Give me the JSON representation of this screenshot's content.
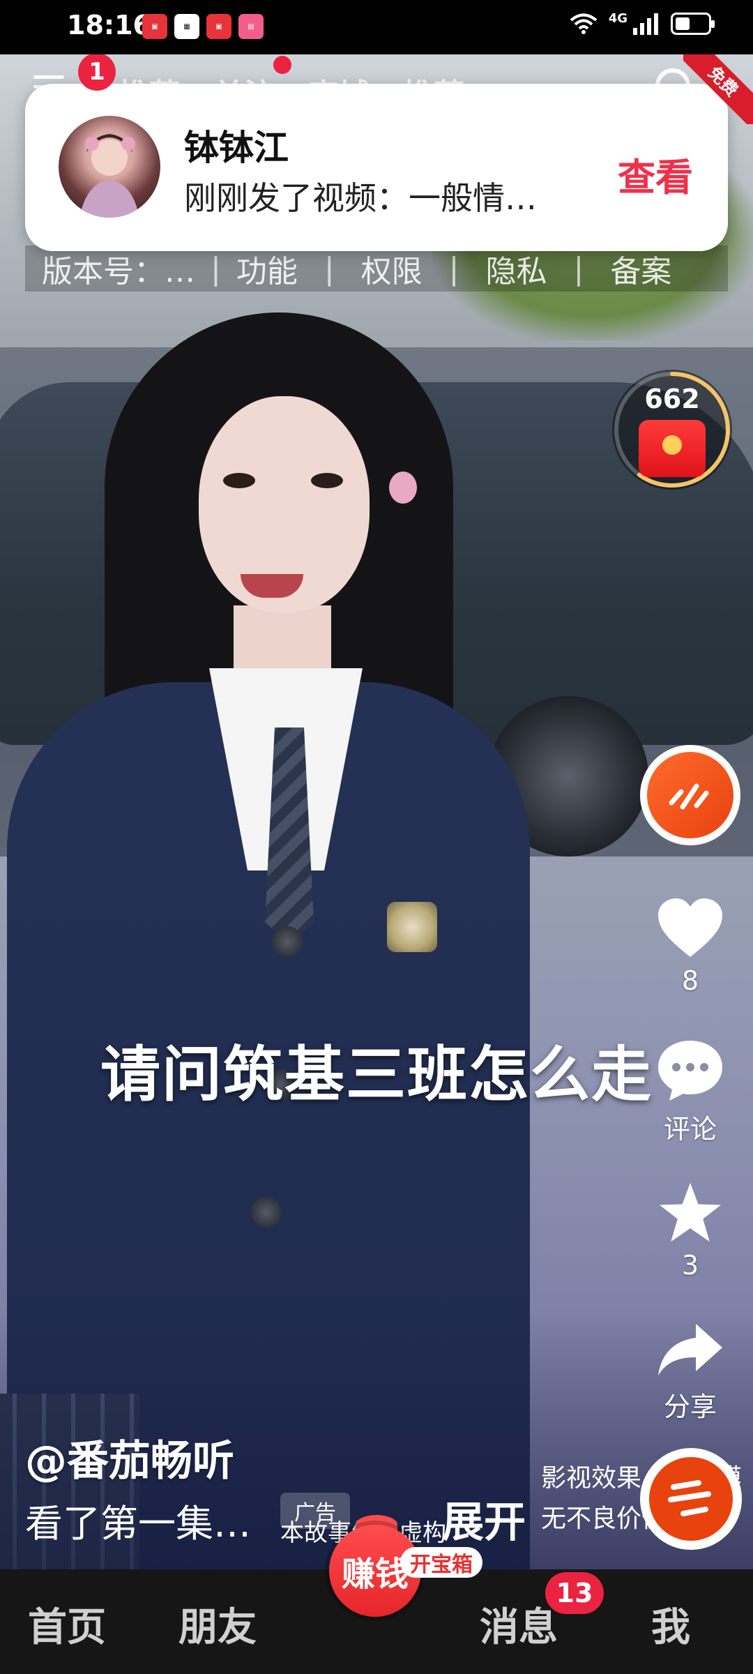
{
  "status_bar": {
    "time": "18:16",
    "network": "4G",
    "battery_level": 0.45,
    "icons": [
      "huawei-appgallery-icon",
      "calendar-icon",
      "huawei-appgallery-icon",
      "bilibili-icon",
      "wifi-icon",
      "signal-icon",
      "battery-icon"
    ]
  },
  "top_nav": {
    "menu_badge": "1",
    "tabs": [
      "推荐",
      "关注",
      "商城",
      "推荐"
    ],
    "corner_label": "免费"
  },
  "notification": {
    "name": "钵钵江",
    "text": "刚刚发了视频：一般情…",
    "action": "查看"
  },
  "version_strip": {
    "items": [
      "版本号：…",
      "功能",
      "权限",
      "隐私",
      "备案"
    ],
    "separator": "|"
  },
  "coin_widget": {
    "count": "662",
    "progress": 0.6
  },
  "subtitle": "请问筑基三班怎么走",
  "actions": {
    "like_count": "8",
    "comment_label": "评论",
    "favorite_count": "3",
    "share_label": "分享"
  },
  "post": {
    "author": "@番茄畅听",
    "caption": "看了第一集…",
    "ad_tag": "广告",
    "disclaimer": "本故事纯属虚构",
    "expand": "展开",
    "side_note_1": "影视效果，请勿模",
    "side_note_2": "无不良价值导"
  },
  "tab_bar": {
    "home": "首页",
    "friends": "朋友",
    "earn": "赚钱",
    "treasure": "开宝箱",
    "messages": "消息",
    "messages_badge": "13",
    "me": "我"
  },
  "colors": {
    "accent_red": "#ea2340",
    "action_red": "#f0304a",
    "music_orange": "#e8420f",
    "tab_bar_bg": "#161616"
  }
}
